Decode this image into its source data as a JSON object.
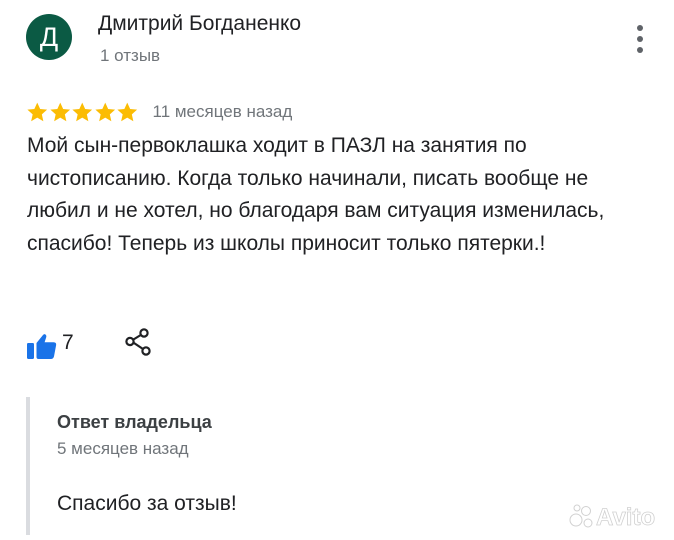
{
  "reviewer": {
    "initial": "Д",
    "name": "Дмитрий Богданенко",
    "review_count": "1 отзыв",
    "avatar_color": "#0b5a44"
  },
  "review": {
    "rating": 5,
    "max_rating": 5,
    "star_color": "#fbbc04",
    "date": "11 месяцев назад",
    "text": "Мой сын-первоклашка ходит в ПАЗЛ на занятия по чистописанию. Когда только начинали, писать вообще не любил и не хотел, но благодаря вам ситуация изменилась, спасибо! Теперь из школы приносит только пятерки.!"
  },
  "actions": {
    "like_icon": "thumbs-up-icon",
    "like_count": "7",
    "like_color": "#1a73e8",
    "share_icon": "share-icon",
    "menu_icon": "more-vert-icon"
  },
  "owner_reply": {
    "title": "Ответ владельца",
    "date": "5 месяцев назад",
    "text": "Спасибо за отзыв!"
  },
  "watermark": {
    "logo_text": "Avito"
  }
}
